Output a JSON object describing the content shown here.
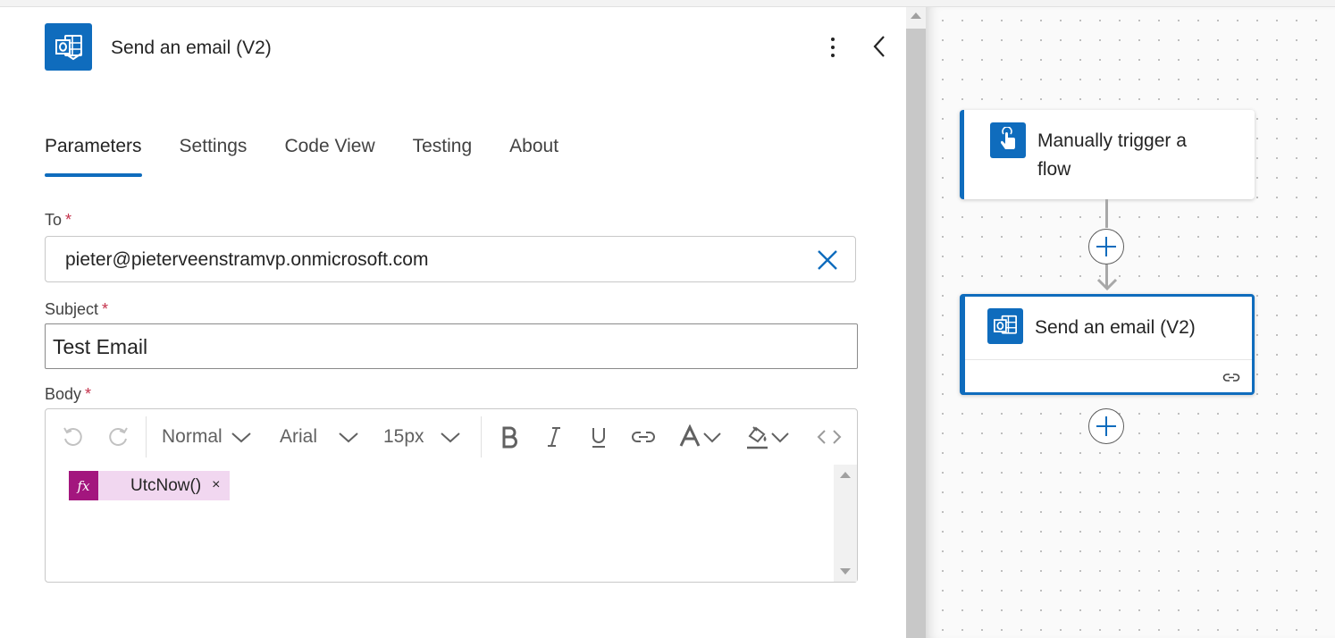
{
  "action": {
    "title": "Send an email (V2)",
    "icon": "outlook-icon"
  },
  "tabs": [
    {
      "label": "Parameters",
      "active": true
    },
    {
      "label": "Settings",
      "active": false
    },
    {
      "label": "Code View",
      "active": false
    },
    {
      "label": "Testing",
      "active": false
    },
    {
      "label": "About",
      "active": false
    }
  ],
  "fields": {
    "to": {
      "label": "To",
      "required_mark": "*",
      "value": "pieter@pieterveenstramvp.onmicrosoft.com"
    },
    "subject": {
      "label": "Subject",
      "required_mark": "*",
      "value": "Test Email"
    },
    "body": {
      "label": "Body",
      "required_mark": "*"
    }
  },
  "toolbar": {
    "style": "Normal",
    "font": "Arial",
    "size": "15px"
  },
  "body_token": {
    "fx_label": "fx",
    "text": "UtcNow()",
    "remove": "×"
  },
  "flow": {
    "trigger": {
      "line1": "Manually trigger a",
      "line2": "flow",
      "icon": "touch-icon"
    },
    "action": {
      "title": "Send an email (V2)",
      "icon": "outlook-icon"
    }
  },
  "colors": {
    "accent": "#0f6cbd",
    "required": "#c4314b",
    "token": "#a3167e",
    "token_bg": "#f1d7f0"
  }
}
